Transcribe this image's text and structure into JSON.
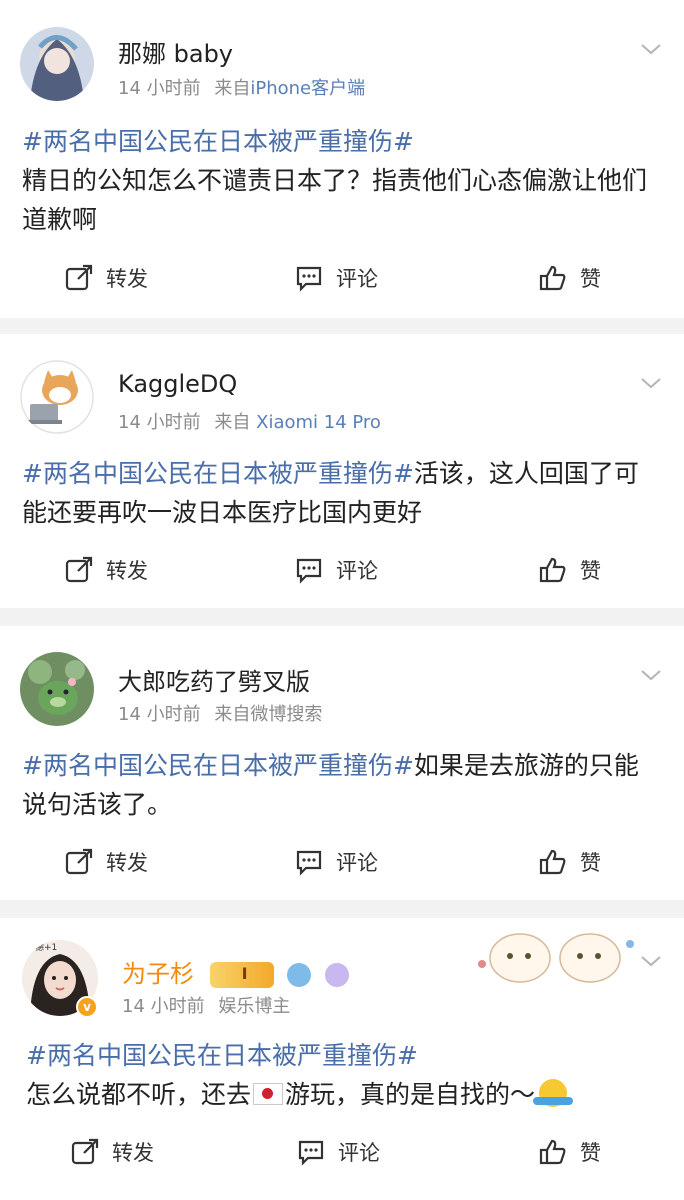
{
  "posts": [
    {
      "username": "那娜 baby",
      "time": "14 小时前",
      "source_prefix": "来自",
      "source": "iPhone客户端",
      "hashtag": "#两名中国公民在日本被严重撞伤#",
      "text": "精日的公知怎么不谴责日本了？指责他们心态偏激让他们道歉啊",
      "actions": {
        "repost": "转发",
        "comment": "评论",
        "like": "赞"
      }
    },
    {
      "username": "KaggleDQ",
      "time": "14 小时前",
      "source_prefix": "来自",
      "source": "Xiaomi 14 Pro",
      "hashtag": "#两名中国公民在日本被严重撞伤#",
      "text": "活该，这人回国了可能还要再吹一波日本医疗比国内更好",
      "actions": {
        "repost": "转发",
        "comment": "评论",
        "like": "赞"
      }
    },
    {
      "username": "大郎吃药了劈叉版",
      "time": "14 小时前",
      "source_prefix": "来自",
      "source": "微博搜索",
      "hashtag": "#两名中国公民在日本被严重撞伤#",
      "text": "如果是去旅游的只能说句活该了。",
      "actions": {
        "repost": "转发",
        "comment": "评论",
        "like": "赞"
      }
    },
    {
      "username": "为子杉",
      "time": "14 小时前",
      "source": "娱乐博主",
      "hashtag": "#两名中国公民在日本被严重撞伤#",
      "text_before_flag": "怎么说都不听，还去",
      "text_after_flag": "游玩，真的是自找的～",
      "actions": {
        "repost": "转发",
        "comment": "评论",
        "like": "赞"
      },
      "avatar_caption": "功德+1",
      "verified_badge": "v"
    }
  ],
  "icons": {
    "repost": "repost-icon",
    "comment": "comment-icon",
    "like": "thumbs-up-icon",
    "menu": "chevron-down-icon"
  },
  "colors": {
    "hashtag": "#4a6ea9",
    "vip_name": "#f38a0a",
    "meta": "#8b8b8b"
  }
}
